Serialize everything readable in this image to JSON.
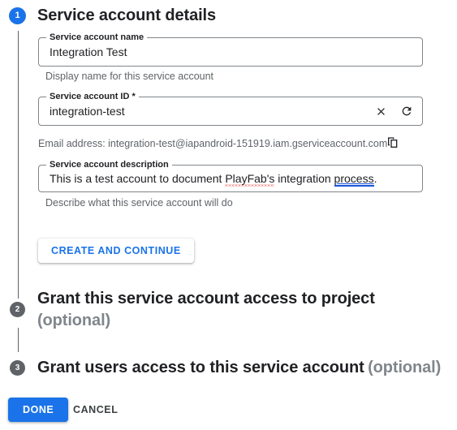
{
  "colors": {
    "accent": "#1a73e8",
    "badge_inactive": "#5f6368",
    "text_primary": "#202124",
    "text_muted": "#5f6368",
    "text_optional": "#80868b",
    "field_border": "#80868b",
    "spell_error": "#e53935",
    "grammar_hint": "#1a56db"
  },
  "steps": [
    {
      "number": "1",
      "title": "Service account details",
      "state": "active"
    },
    {
      "number": "2",
      "title": "Grant this service account access to project",
      "optional": "(optional)",
      "state": "inactive"
    },
    {
      "number": "3",
      "title": "Grant users access to this service account",
      "optional": "(optional)",
      "state": "inactive"
    }
  ],
  "form": {
    "name_field": {
      "label": "Service account name",
      "value": "Integration Test",
      "helper": "Display name for this service account"
    },
    "id_field": {
      "label": "Service account ID *",
      "value": "integration-test",
      "clear_icon": "close-icon",
      "refresh_icon": "refresh-icon"
    },
    "email_row": {
      "text": "Email address: integration-test@iapandroid-151919.iam.gserviceaccount.com",
      "copy_icon": "copy-icon"
    },
    "description_field": {
      "label": "Service account description",
      "value_part1": "This is a test account to document ",
      "value_spell_error": "PlayFab's",
      "value_part2": " integration ",
      "value_grammar_hint": "process",
      "value_part3": ".",
      "helper": "Describe what this service account will do"
    },
    "create_button": "CREATE AND CONTINUE"
  },
  "footer": {
    "done_button": "DONE",
    "cancel_button": "CANCEL"
  }
}
